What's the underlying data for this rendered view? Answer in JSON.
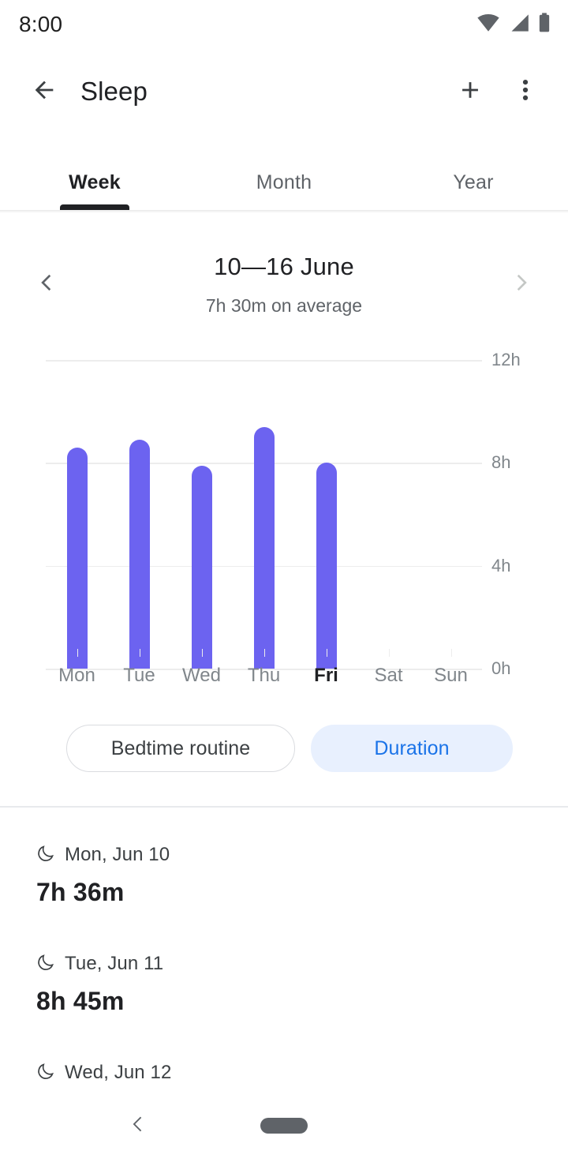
{
  "status_bar": {
    "time": "8:00",
    "icons": [
      "wifi-icon",
      "cellular-icon",
      "battery-icon"
    ]
  },
  "app_bar": {
    "back_icon": "back-arrow-icon",
    "title": "Sleep",
    "add_icon": "plus-icon",
    "overflow_icon": "more-vert-icon"
  },
  "tabs": {
    "items": [
      {
        "label": "Week",
        "active": true
      },
      {
        "label": "Month",
        "active": false
      },
      {
        "label": "Year",
        "active": false
      }
    ]
  },
  "range": {
    "title": "10—16 June",
    "subtitle": "7h 30m on average",
    "prev_icon": "chevron-left-icon",
    "next_icon": "chevron-right-icon"
  },
  "chart_data": {
    "type": "bar",
    "title": "10—16 June",
    "subtitle": "7h 30m on average",
    "xlabel": "",
    "ylabel": "",
    "ylim": [
      0,
      12
    ],
    "yticks": [
      0,
      4,
      8,
      12
    ],
    "ytick_labels": [
      "0h",
      "4h",
      "8h",
      "12h"
    ],
    "grid": true,
    "legend": false,
    "bar_color": "#6c63f0",
    "categories": [
      "Mon",
      "Tue",
      "Wed",
      "Thu",
      "Fri",
      "Sat",
      "Sun"
    ],
    "values": [
      8.6,
      8.9,
      7.9,
      9.4,
      8.0,
      null,
      null
    ],
    "value_labels": [
      "7h 36m",
      "8h 45m",
      "",
      "",
      "",
      "",
      ""
    ],
    "highlighted_category": "Fri"
  },
  "chips": {
    "items": [
      {
        "label": "Bedtime routine",
        "selected": false
      },
      {
        "label": "Duration",
        "selected": true
      }
    ]
  },
  "list": {
    "items": [
      {
        "icon": "moon-icon",
        "date": "Mon, Jun 10",
        "value": "7h 36m"
      },
      {
        "icon": "moon-icon",
        "date": "Tue, Jun 11",
        "value": "8h 45m"
      },
      {
        "icon": "moon-icon",
        "date": "Wed, Jun 12",
        "value": ""
      }
    ]
  },
  "nav_bar": {
    "back_icon": "nav-back-icon",
    "home_icon": "nav-home-pill"
  },
  "colors": {
    "accent_bar": "#6c63f0",
    "chip_selected_bg": "#e8f0fe",
    "chip_selected_text": "#1a73e8",
    "text_primary": "#202124",
    "text_secondary": "#5f6368"
  }
}
